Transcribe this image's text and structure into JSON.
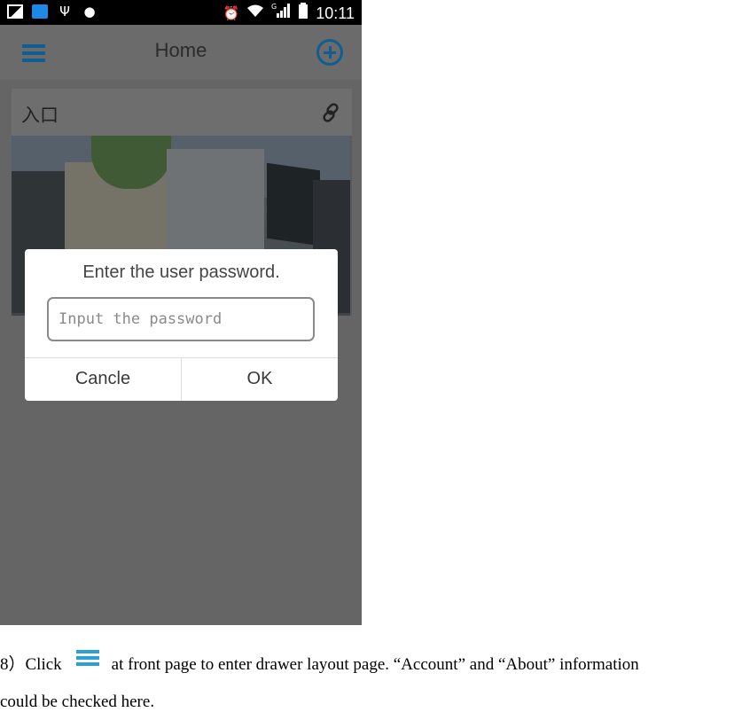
{
  "status_bar": {
    "time": "10:11",
    "left_icons": [
      "image-icon",
      "notification-icon",
      "usb-icon",
      "android-icon"
    ],
    "right_icons": [
      "alarm-icon",
      "wifi-icon",
      "signal-icon",
      "battery-icon"
    ],
    "signal_label": "G"
  },
  "app_bar": {
    "title": "Home",
    "menu_icon": "menu-icon",
    "add_icon": "add-circle-icon",
    "accent_color": "#0e5e94"
  },
  "card": {
    "title": "入口",
    "link_icon": "link-icon"
  },
  "dialog": {
    "title": "Enter the user password.",
    "input_placeholder": "Input the password",
    "input_value": "",
    "cancel_label": "Cancle",
    "ok_label": "OK"
  },
  "caption": {
    "prefix": "8）Click",
    "icon": "menu-icon",
    "line1_rest": "at front page to enter drawer layout page. “Account” and “About” information",
    "line2": "could be checked here.",
    "icon_color": "#2a9fd8"
  }
}
